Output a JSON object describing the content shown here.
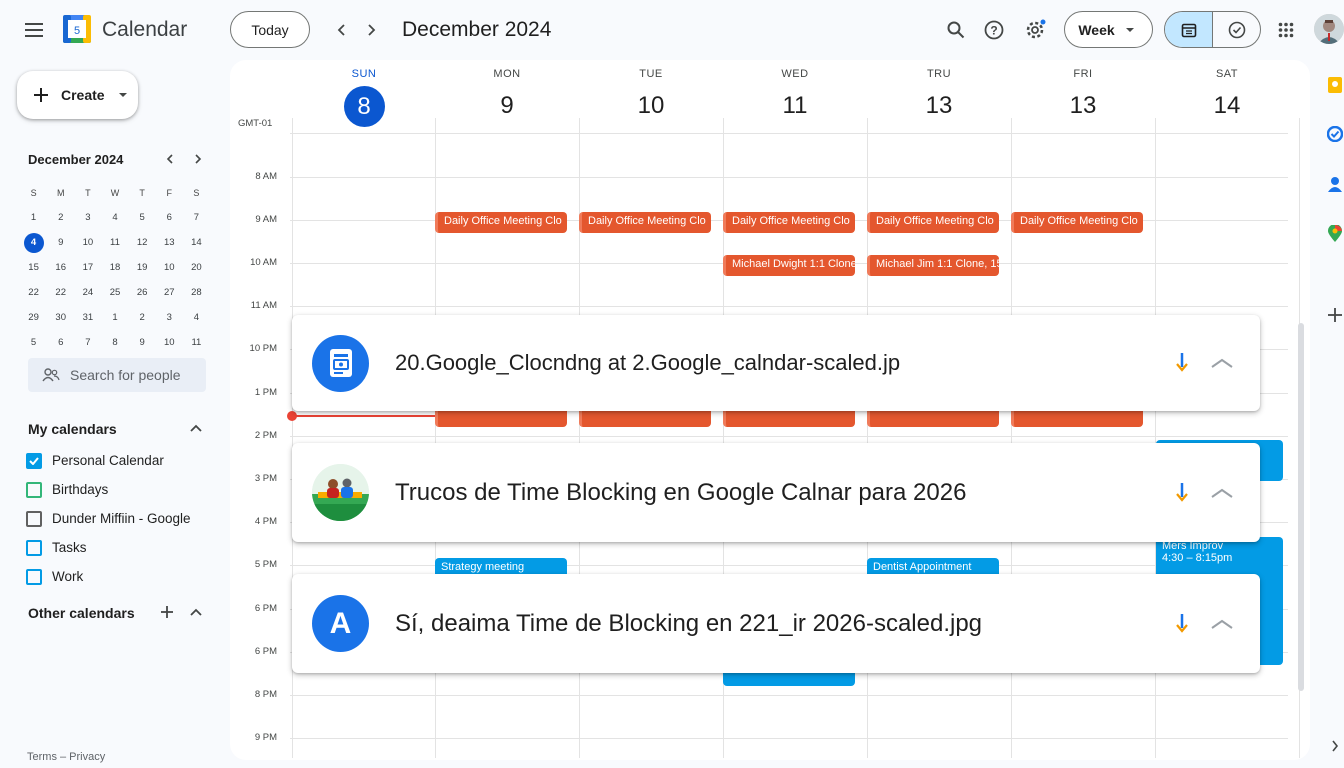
{
  "header": {
    "app_title": "Calendar",
    "logo_day": "5",
    "today_label": "Today",
    "period_title": "December 2024",
    "view_label": "Week",
    "avatar_alt": "user-avatar"
  },
  "sidebar": {
    "create_label": "Create",
    "mini_title": "December 2024",
    "mini_weekdays": [
      "S",
      "M",
      "T",
      "W",
      "T",
      "F",
      "S"
    ],
    "mini_weeks": [
      [
        "1",
        "2",
        "3",
        "4",
        "5",
        "6",
        "7"
      ],
      [
        "4",
        "9",
        "10",
        "11",
        "12",
        "13",
        "14"
      ],
      [
        "15",
        "16",
        "17",
        "18",
        "19",
        "10",
        "20"
      ],
      [
        "22",
        "22",
        "24",
        "25",
        "26",
        "27",
        "28"
      ],
      [
        "29",
        "30",
        "31",
        "1",
        "2",
        "3",
        "4"
      ],
      [
        "5",
        "6",
        "7",
        "8",
        "9",
        "10",
        "11"
      ]
    ],
    "mini_selected": "4",
    "search_placeholder": "Search for people",
    "my_calendars_title": "My calendars",
    "my_calendars": [
      {
        "label": "Personal Calendar",
        "checked": true,
        "color": "#039be5"
      },
      {
        "label": "Birthdays",
        "checked": false,
        "color": "#33b679"
      },
      {
        "label": "Dunder Miffiin - Google",
        "checked": false,
        "color": "#616161"
      },
      {
        "label": "Tasks",
        "checked": false,
        "color": "#039be5"
      },
      {
        "label": "Work",
        "checked": false,
        "color": "#039be5"
      }
    ],
    "other_calendars_title": "Other calendars",
    "footer": "Terms – Privacy"
  },
  "week": {
    "timezone": "GMT-01",
    "days": [
      {
        "name": "SUN",
        "num": "8",
        "today": true
      },
      {
        "name": "MON",
        "num": "9",
        "today": false
      },
      {
        "name": "TUE",
        "num": "10",
        "today": false
      },
      {
        "name": "WED",
        "num": "11",
        "today": false
      },
      {
        "name": "TRU",
        "num": "13",
        "today": false
      },
      {
        "name": "FRI",
        "num": "13",
        "today": false
      },
      {
        "name": "SAT",
        "num": "14",
        "today": false
      }
    ],
    "hours": [
      "8 AM",
      "9 AM",
      "10 AM",
      "11 AM",
      "10 PM",
      "1 PM",
      "2 PM",
      "3 PM",
      "4 PM",
      "5 PM",
      "6 PM",
      "6 PM",
      "8 PM",
      "9 PM"
    ],
    "meeting_label": "Daily Office Meeting Clo",
    "wed_10_label": "Michael Dwight 1:1 Clone",
    "thu_10_label": "Michael Jim 1:1 Clone, 15",
    "tue_5pm_label": "Strategy meeting",
    "thu_5pm_label": "Dentist Appointment",
    "sat_5pm_title": "Mers Improv",
    "sat_5pm_time": "4:30 – 8:15pm"
  },
  "cards": [
    {
      "title": "20.Google_Clocndng at 2.Google_calndar-scaled.jp",
      "icon": "document-icon",
      "icon_bg": "#1a73e8"
    },
    {
      "title": "Trucos de Time Blocking en Google Calnar para 2026",
      "icon": "people-thumbnail-icon",
      "icon_bg": "#e6f4ea"
    },
    {
      "title": "Sí, deaima Time de Blocking en 221_ir 2026-scaled.jpg",
      "icon": "letter-a-icon",
      "letter": "A",
      "icon_bg": "#1a73e8"
    }
  ],
  "colors": {
    "accent": "#0b57d0",
    "event_orange": "#e4572e",
    "event_blue": "#039be5"
  }
}
